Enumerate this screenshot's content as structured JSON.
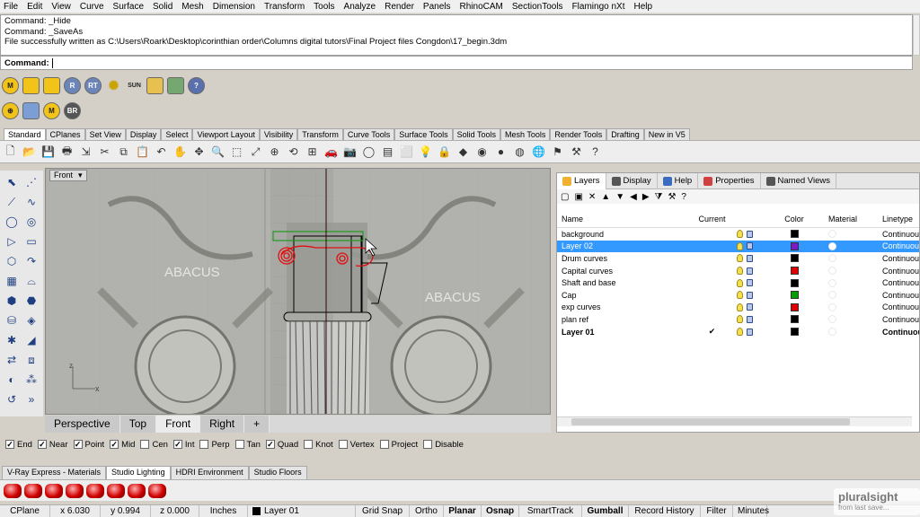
{
  "menu": [
    "File",
    "Edit",
    "View",
    "Curve",
    "Surface",
    "Solid",
    "Mesh",
    "Dimension",
    "Transform",
    "Tools",
    "Analyze",
    "Render",
    "Panels",
    "RhinoCAM",
    "SectionTools",
    "Flamingo nXt",
    "Help"
  ],
  "command_history": [
    "Command: _Hide",
    "Command: _SaveAs",
    "File successfully written as C:\\Users\\Roark\\Desktop\\corinthian order\\Columns digital tutors\\Final Project files Congdon\\17_begin.3dm"
  ],
  "command_prompt": "Command:",
  "plugin_row1": [
    "M",
    "",
    "",
    "R",
    "RT",
    "",
    "SUN",
    "",
    "",
    ""
  ],
  "plugin_row2": [
    "",
    "",
    "M",
    "BR"
  ],
  "toolbar_tabs": [
    "Standard",
    "CPlanes",
    "Set View",
    "Display",
    "Select",
    "Viewport Layout",
    "Visibility",
    "Transform",
    "Curve Tools",
    "Surface Tools",
    "Solid Tools",
    "Mesh Tools",
    "Render Tools",
    "Drafting",
    "New in V5"
  ],
  "viewport": {
    "label": "Front",
    "dropdown": "▾",
    "texts": [
      "ABACUS",
      "ABACUS"
    ],
    "axis_x": "x",
    "axis_z": "z"
  },
  "viewport_tabs": [
    "Perspective",
    "Top",
    "Front",
    "Right",
    "+"
  ],
  "osnaps": [
    {
      "label": "End",
      "checked": true
    },
    {
      "label": "Near",
      "checked": true
    },
    {
      "label": "Point",
      "checked": true
    },
    {
      "label": "Mid",
      "checked": true
    },
    {
      "label": "Cen",
      "checked": false
    },
    {
      "label": "Int",
      "checked": true
    },
    {
      "label": "Perp",
      "checked": false
    },
    {
      "label": "Tan",
      "checked": false
    },
    {
      "label": "Quad",
      "checked": true
    },
    {
      "label": "Knot",
      "checked": false
    },
    {
      "label": "Vertex",
      "checked": false
    },
    {
      "label": "Project",
      "checked": false
    },
    {
      "label": "Disable",
      "checked": false
    }
  ],
  "lower_tabs": [
    "V-Ray Express - Materials",
    "Studio Lighting",
    "HDRI Environment",
    "Studio Floors"
  ],
  "status": [
    "CPlane",
    "x 6.030",
    "y 0.994",
    "z 0.000",
    "Inches",
    "Layer 01",
    "Grid Snap",
    "Ortho",
    "Planar",
    "Osnap",
    "SmartTrack",
    "Gumball",
    "Record History",
    "Filter",
    "Minutes"
  ],
  "panel": {
    "tabs": [
      "Layers",
      "Display",
      "Help",
      "Properties",
      "Named Views"
    ],
    "columns": [
      "Name",
      "Current",
      "Color",
      "Material",
      "Linetype"
    ],
    "layers": [
      {
        "name": "background",
        "current": "",
        "color": "#000000",
        "linetype": "Continuous"
      },
      {
        "name": "Layer 02",
        "current": "",
        "color": "#7b1ac7",
        "linetype": "Continuous",
        "selected": true
      },
      {
        "name": "Drum curves",
        "current": "",
        "color": "#000000",
        "linetype": "Continuous"
      },
      {
        "name": "Capital curves",
        "current": "",
        "color": "#e00000",
        "linetype": "Continuous"
      },
      {
        "name": "Shaft and base",
        "current": "",
        "color": "#000000",
        "linetype": "Continuous"
      },
      {
        "name": "Cap",
        "current": "",
        "color": "#00a000",
        "linetype": "Continuous"
      },
      {
        "name": "exp curves",
        "current": "",
        "color": "#e00000",
        "linetype": "Continuous"
      },
      {
        "name": "plan ref",
        "current": "",
        "color": "#000000",
        "linetype": "Continuous"
      },
      {
        "name": "Layer 01",
        "current": "✔",
        "color": "#000000",
        "linetype": "Continuous",
        "bold": true
      }
    ]
  },
  "watermark": {
    "logo": "pluralsight",
    "sub": "from last save..."
  }
}
